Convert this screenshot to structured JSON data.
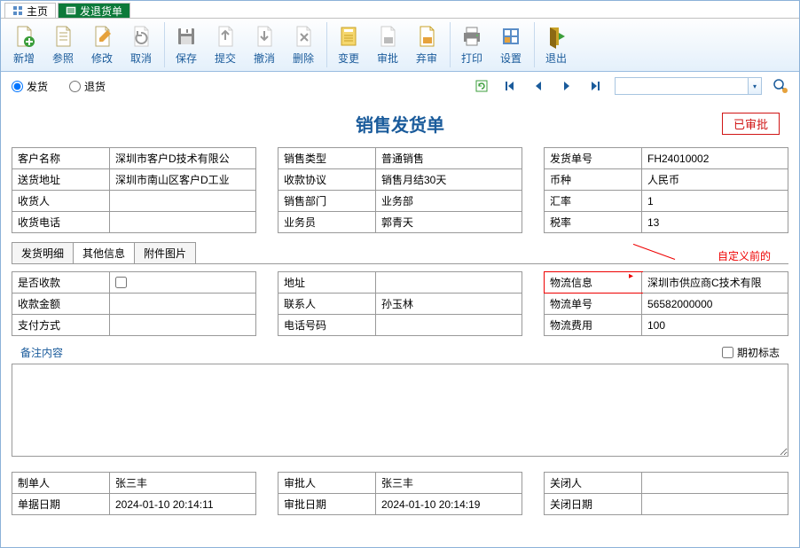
{
  "tabs": {
    "home": "主页",
    "doc": "发退货单"
  },
  "toolbar": {
    "new": "新增",
    "ref": "参照",
    "edit": "修改",
    "cancel": "取消",
    "save": "保存",
    "submit": "提交",
    "revoke": "撤消",
    "delete": "删除",
    "change": "变更",
    "approve": "审批",
    "reject": "弃审",
    "print": "打印",
    "settings": "设置",
    "exit": "退出"
  },
  "subbar": {
    "r1": "发货",
    "r2": "退货"
  },
  "title": "销售发货单",
  "stamp": "已审批",
  "block1": {
    "l1": "客户名称",
    "v1": "深圳市客户D技术有限公",
    "l2": "送货地址",
    "v2": "深圳市南山区客户D工业",
    "l3": "收货人",
    "v3": "",
    "l4": "收货电话",
    "v4": ""
  },
  "block2": {
    "l1": "销售类型",
    "v1": "普通销售",
    "l2": "收款协议",
    "v2": "销售月结30天",
    "l3": "销售部门",
    "v3": "业务部",
    "l4": "业务员",
    "v4": "郭青天"
  },
  "block3": {
    "l1": "发货单号",
    "v1": "FH24010002",
    "l2": "币种",
    "v2": "人民币",
    "l3": "汇率",
    "v3": "1",
    "l4": "税率",
    "v4": "13"
  },
  "innerTabs": {
    "t1": "发货明细",
    "t2": "其他信息",
    "t3": "附件图片"
  },
  "annotation": "自定义前的",
  "ib1": {
    "l1": "是否收款",
    "l2": "收款金额",
    "v2": "",
    "l3": "支付方式",
    "v3": ""
  },
  "ib2": {
    "l1": "地址",
    "v1": "",
    "l2": "联系人",
    "v2": "孙玉林",
    "l3": "电话号码",
    "v3": ""
  },
  "ib3": {
    "l1": "物流信息",
    "v1": "深圳市供应商C技术有限",
    "l2": "物流单号",
    "v2": "56582000000",
    "l3": "物流费用",
    "v3": "100"
  },
  "remarks": {
    "label": "备注内容",
    "checkbox": "期初标志"
  },
  "footer1": {
    "l1": "制单人",
    "v1": "张三丰",
    "l2": "单据日期",
    "v2": "2024-01-10 20:14:11"
  },
  "footer2": {
    "l1": "审批人",
    "v1": "张三丰",
    "l2": "审批日期",
    "v2": "2024-01-10 20:14:19"
  },
  "footer3": {
    "l1": "关闭人",
    "v1": "",
    "l2": "关闭日期",
    "v2": ""
  }
}
